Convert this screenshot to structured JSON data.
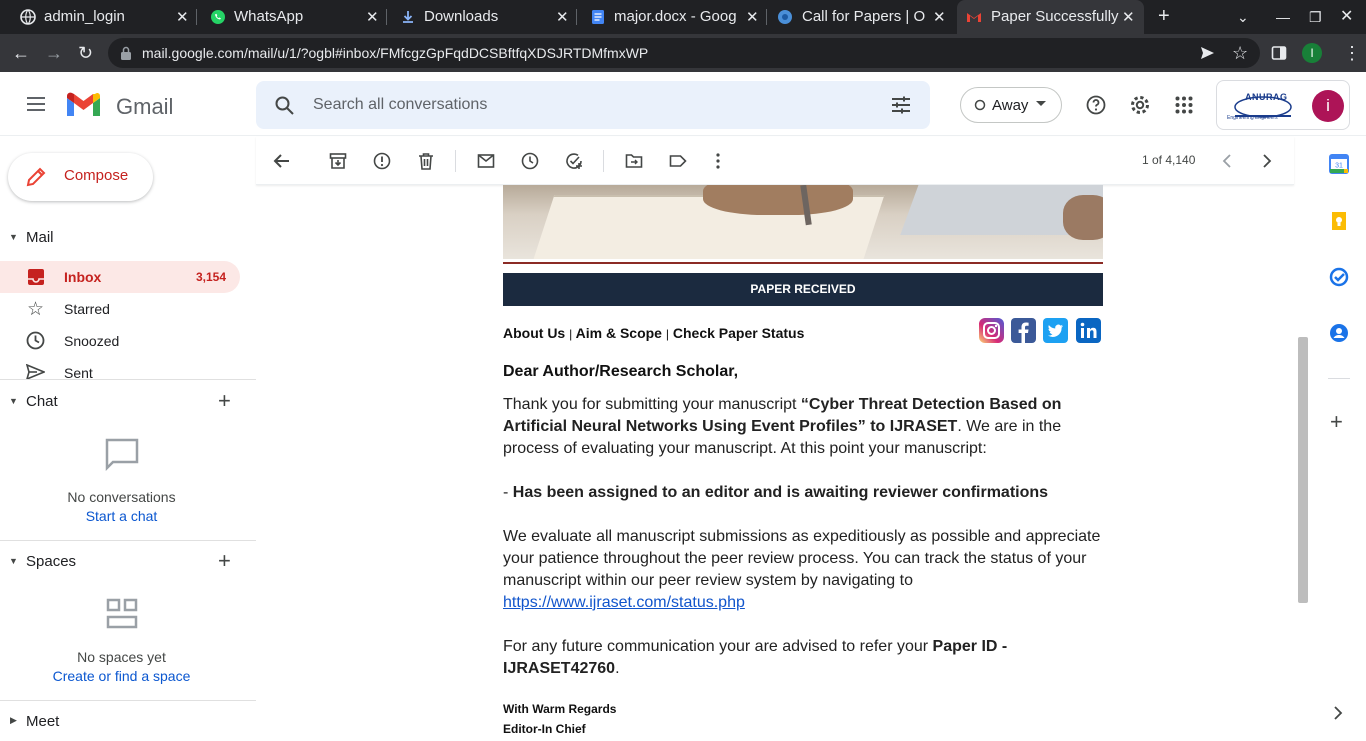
{
  "browser": {
    "tabs": [
      {
        "title": "admin_login",
        "icon": "globe-icon"
      },
      {
        "title": "WhatsApp",
        "icon": "whatsapp-icon"
      },
      {
        "title": "Downloads",
        "icon": "download-icon"
      },
      {
        "title": "major.docx - Goog",
        "icon": "docs-icon"
      },
      {
        "title": "Call for Papers | O",
        "icon": "site-icon"
      },
      {
        "title": "Paper Successfully",
        "icon": "gmail-icon"
      }
    ],
    "url": "mail.google.com/mail/u/1/?ogbl#inbox/FMfcgzGpFqdDCSBftfqXDSJRTDMfmxWP",
    "profile_initial": "I"
  },
  "gmail": {
    "logo_text": "Gmail",
    "search_placeholder": "Search all conversations",
    "status": "Away",
    "account_initial": "i",
    "org_logo_text": "ANURAG",
    "org_logo_sub": "Engineering Engineers"
  },
  "sidebar": {
    "compose_label": "Compose",
    "mail_header": "Mail",
    "items": [
      {
        "label": "Inbox",
        "count": "3,154",
        "icon": "inbox-icon"
      },
      {
        "label": "Starred",
        "icon": "star-icon"
      },
      {
        "label": "Snoozed",
        "icon": "clock-icon"
      },
      {
        "label": "Sent",
        "icon": "send-icon"
      }
    ],
    "chat_header": "Chat",
    "chat_empty": "No conversations",
    "chat_link": "Start a chat",
    "spaces_header": "Spaces",
    "spaces_empty": "No spaces yet",
    "spaces_link": "Create or find a space",
    "meet_header": "Meet"
  },
  "toolbar": {
    "pagination": "1 of 4,140"
  },
  "email": {
    "banner": "PAPER RECEIVED",
    "nav_links": [
      "About Us",
      "Aim & Scope",
      "Check Paper Status"
    ],
    "nav_sep": "|",
    "greeting": "Dear Author/Research Scholar,",
    "p1_a": "Thank you for submitting your manuscript ",
    "p1_title": "“Cyber Threat Detection Based on Artificial Neural Networks Using Event Profiles” to IJRASET",
    "p1_b": ". We are in the process of evaluating your manuscript. At this point your manuscript:",
    "status_dash": "- ",
    "status_text": "Has been assigned to an editor and is awaiting reviewer confirmations",
    "p2": "We evaluate all manuscript submissions as expeditiously as possible and appreciate your patience throughout the peer review process. You can track the status of your manuscript within our peer review system by navigating to ",
    "p2_link": "https://www.ijraset.com/status.php",
    "p3_a": "For any future communication your are advised to refer your ",
    "p3_id": "Paper ID - IJRASET42760",
    "p3_b": ".",
    "regards": "With Warm Regards",
    "signature": "Editor-In Chief"
  }
}
